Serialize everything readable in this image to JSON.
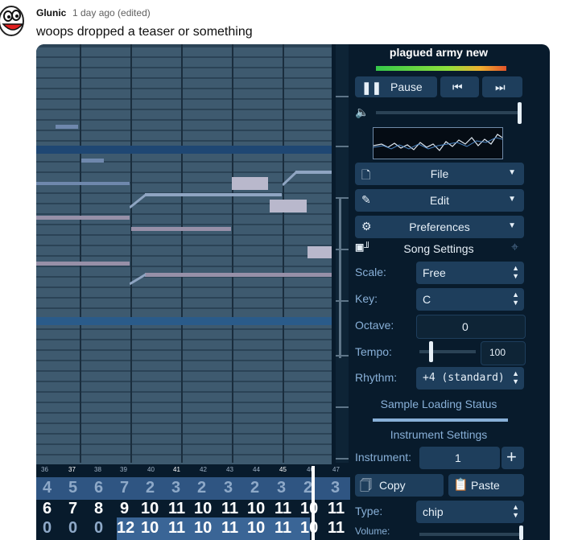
{
  "comment": {
    "author": "Glunic",
    "meta": "1 day ago (edited)",
    "text": "woops dropped a teaser or something"
  },
  "app": {
    "song_title": "plagued army new",
    "play_label": "Pause",
    "menus": [
      {
        "icon": "file-icon",
        "label": "File"
      },
      {
        "icon": "pencil-icon",
        "label": "Edit"
      },
      {
        "icon": "gear-icon",
        "label": "Preferences"
      }
    ],
    "song_settings": "Song Settings",
    "scale": {
      "label": "Scale:",
      "value": "Free"
    },
    "key": {
      "label": "Key:",
      "value": "C"
    },
    "octave": {
      "label": "Octave:",
      "value": "0"
    },
    "tempo": {
      "label": "Tempo:",
      "value": "100"
    },
    "rhythm": {
      "label": "Rhythm:",
      "value": "+4 (standard)"
    },
    "sample_status": "Sample Loading Status",
    "instrument_settings": "Instrument Settings",
    "instrument": {
      "label": "Instrument:",
      "value": "1"
    },
    "copy": "Copy",
    "paste": "Paste",
    "type": {
      "label": "Type:",
      "value": "chip"
    },
    "volume_label": "Volume:",
    "accent": "#88b0d8",
    "panel_bg": "#1e3e5c"
  },
  "tracker": {
    "beats": [
      "36",
      "37",
      "38",
      "39",
      "40",
      "41",
      "42",
      "43",
      "44",
      "45",
      "46",
      "47"
    ],
    "rows": [
      [
        "4",
        "5",
        "6",
        "7",
        "2",
        "3",
        "2",
        "3",
        "2",
        "3",
        "2",
        "3"
      ],
      [
        "6",
        "7",
        "8",
        "9",
        "10",
        "11",
        "10",
        "11",
        "10",
        "11",
        "10",
        "11"
      ],
      [
        "0",
        "0",
        "0",
        "12",
        "10",
        "11",
        "10",
        "11",
        "10",
        "11",
        "10",
        "11"
      ]
    ]
  }
}
